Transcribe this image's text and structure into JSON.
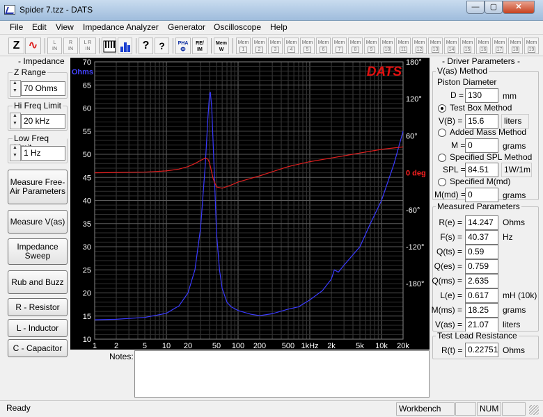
{
  "window": {
    "title": "Spider 7.tzz - DATS",
    "minimize_label": "—",
    "maximize_label": "▢",
    "close_label": "✕"
  },
  "menu": [
    "File",
    "Edit",
    "View",
    "Impedance Analyzer",
    "Generator",
    "Oscilloscope",
    "Help"
  ],
  "toolbar": {
    "mode_buttons": [
      {
        "icon": "impedance-z-icon",
        "label": "Z"
      },
      {
        "icon": "sine-wave-icon",
        "label": "∿"
      }
    ],
    "channel_buttons": [
      {
        "top": "L",
        "bottom": "IN"
      },
      {
        "top": "R",
        "bottom": "IN"
      },
      {
        "top": "L R",
        "bottom": "IN"
      }
    ],
    "view_buttons": [
      {
        "icon": "piano-keys-icon"
      },
      {
        "icon": "bar-spectrum-icon"
      }
    ],
    "help_buttons": [
      {
        "icon": "help-question-icon",
        "label": "?"
      },
      {
        "icon": "context-help-icon",
        "label": "?"
      }
    ],
    "pha_label": "PHA",
    "pha_sub": "Φ",
    "reim_label": "RE/",
    "reim_sub": "IM",
    "memw_label": "Mem",
    "memw_sub": "W",
    "mem_label": "Mem",
    "mem_slots": [
      "1",
      "2",
      "3",
      "4",
      "5",
      "6",
      "7",
      "8",
      "9",
      "10",
      "11",
      "12",
      "13",
      "14",
      "15",
      "16",
      "17",
      "18",
      "19"
    ]
  },
  "left_panel": {
    "impedance_title": "- Impedance -",
    "z_range": {
      "label": "Z Range",
      "value": "70 Ohms"
    },
    "hi_freq": {
      "label": "Hi Freq Limit",
      "value": "20 kHz"
    },
    "low_freq": {
      "label": "Low Freq Limit",
      "value": "1 Hz"
    },
    "buttons": {
      "measure_free_air": "Measure Free-Air Parameters",
      "measure_vas": "Measure V(as)",
      "impedance_sweep": "Impedance Sweep",
      "rub_buzz": "Rub and Buzz",
      "resistor": "R - Resistor",
      "inductor": "L - Inductor",
      "capacitor": "C - Capacitor"
    }
  },
  "chart_data": {
    "type": "line",
    "brand": "DATS",
    "x_axis": {
      "scale": "log",
      "xlim": [
        1,
        20000
      ],
      "tick_labels": [
        "1",
        "2",
        "5",
        "10",
        "20",
        "50",
        "100",
        "200",
        "500",
        "1kHz",
        "2k",
        "5k",
        "10k",
        "20k"
      ],
      "tick_values": [
        1,
        2,
        5,
        10,
        20,
        50,
        100,
        200,
        500,
        1000,
        2000,
        5000,
        10000,
        20000
      ]
    },
    "y_left": {
      "label": "Ohms",
      "ylim": [
        10,
        70
      ],
      "tick_labels": [
        "70",
        "65",
        "60",
        "55",
        "50",
        "45",
        "40",
        "35",
        "30",
        "25",
        "20",
        "15",
        "10"
      ]
    },
    "y_right": {
      "label": "deg",
      "ylim": [
        -270,
        180
      ],
      "tick_labels": [
        "180°",
        "120°",
        "60°",
        "0 deg",
        "-60°",
        "-120°",
        "-180°"
      ],
      "tick_values": [
        180,
        120,
        60,
        0,
        -60,
        -120,
        -180
      ]
    },
    "grid": true,
    "series": [
      {
        "color": "#3a3aff",
        "axis": "left",
        "points": [
          [
            1,
            14.2
          ],
          [
            2,
            14.3
          ],
          [
            5,
            14.7
          ],
          [
            10,
            15.6
          ],
          [
            15,
            17.2
          ],
          [
            20,
            20
          ],
          [
            25,
            25
          ],
          [
            30,
            34
          ],
          [
            35,
            48
          ],
          [
            38,
            58
          ],
          [
            40,
            63
          ],
          [
            41,
            63.5
          ],
          [
            43,
            60
          ],
          [
            46,
            48
          ],
          [
            50,
            33
          ],
          [
            55,
            25
          ],
          [
            60,
            21
          ],
          [
            70,
            18
          ],
          [
            80,
            17
          ],
          [
            100,
            16.2
          ],
          [
            150,
            15.4
          ],
          [
            200,
            15.1
          ],
          [
            300,
            15.5
          ],
          [
            500,
            16.5
          ],
          [
            700,
            17
          ],
          [
            1000,
            18.5
          ],
          [
            1500,
            20.5
          ],
          [
            2000,
            23
          ],
          [
            2200,
            25
          ],
          [
            2500,
            24.5
          ],
          [
            3000,
            26
          ],
          [
            5000,
            30
          ],
          [
            7000,
            35
          ],
          [
            10000,
            40
          ],
          [
            15000,
            48
          ],
          [
            20000,
            55
          ]
        ]
      },
      {
        "color": "#e02020",
        "axis": "right",
        "points": [
          [
            1,
            0
          ],
          [
            5,
            1
          ],
          [
            10,
            3
          ],
          [
            15,
            6
          ],
          [
            20,
            10
          ],
          [
            25,
            15
          ],
          [
            30,
            20
          ],
          [
            35,
            24
          ],
          [
            38,
            22
          ],
          [
            40,
            16
          ],
          [
            45,
            -10
          ],
          [
            50,
            -23
          ],
          [
            60,
            -25
          ],
          [
            80,
            -20
          ],
          [
            100,
            -15
          ],
          [
            200,
            -5
          ],
          [
            500,
            10
          ],
          [
            1000,
            18
          ],
          [
            2000,
            24
          ],
          [
            5000,
            32
          ],
          [
            10000,
            38
          ],
          [
            20000,
            42
          ]
        ]
      }
    ]
  },
  "notes": {
    "label": "Notes:",
    "value": ""
  },
  "right_panel": {
    "title": "- Driver Parameters -",
    "vas_method": "V(as) Method",
    "piston_diameter": "Piston Diameter",
    "d": {
      "label": "D =",
      "value": "130",
      "unit": "mm"
    },
    "test_box": {
      "label": "Test Box Method",
      "selected": true
    },
    "vb": {
      "label": "V(B) =",
      "value": "15.6",
      "unit": "liters"
    },
    "added_mass": {
      "label": "Added Mass Method",
      "selected": false
    },
    "m": {
      "label": "M =",
      "value": "0",
      "unit": "grams"
    },
    "spl_method": {
      "label": "Specified SPL Method",
      "selected": false
    },
    "spl": {
      "label": "SPL =",
      "value": "84.51",
      "unit": "1W/1m"
    },
    "mmd_method": {
      "label": "Specified M(md)",
      "selected": false
    },
    "mmd": {
      "label": "M(md) =",
      "value": "0",
      "unit": "grams"
    },
    "measured_title": "Measured Parameters",
    "measured": [
      {
        "label": "R(e) =",
        "value": "14.247",
        "unit": "Ohms"
      },
      {
        "label": "F(s) =",
        "value": "40.37",
        "unit": "Hz"
      },
      {
        "label": "Q(ts) =",
        "value": "0.59",
        "unit": ""
      },
      {
        "label": "Q(es) =",
        "value": "0.759",
        "unit": ""
      },
      {
        "label": "Q(ms) =",
        "value": "2.635",
        "unit": ""
      },
      {
        "label": "L(e) =",
        "value": "0.617",
        "unit": "mH (10k)"
      },
      {
        "label": "M(ms) =",
        "value": "18.25",
        "unit": "grams"
      },
      {
        "label": "V(as) =",
        "value": "21.07",
        "unit": "liters"
      }
    ],
    "lead_title": "Test Lead Resistance",
    "rt": {
      "label": "R(t) =",
      "value": "0.22751",
      "unit": "Ohms"
    }
  },
  "status": {
    "left": "Ready",
    "workbench": "Workbench",
    "num": "NUM"
  }
}
